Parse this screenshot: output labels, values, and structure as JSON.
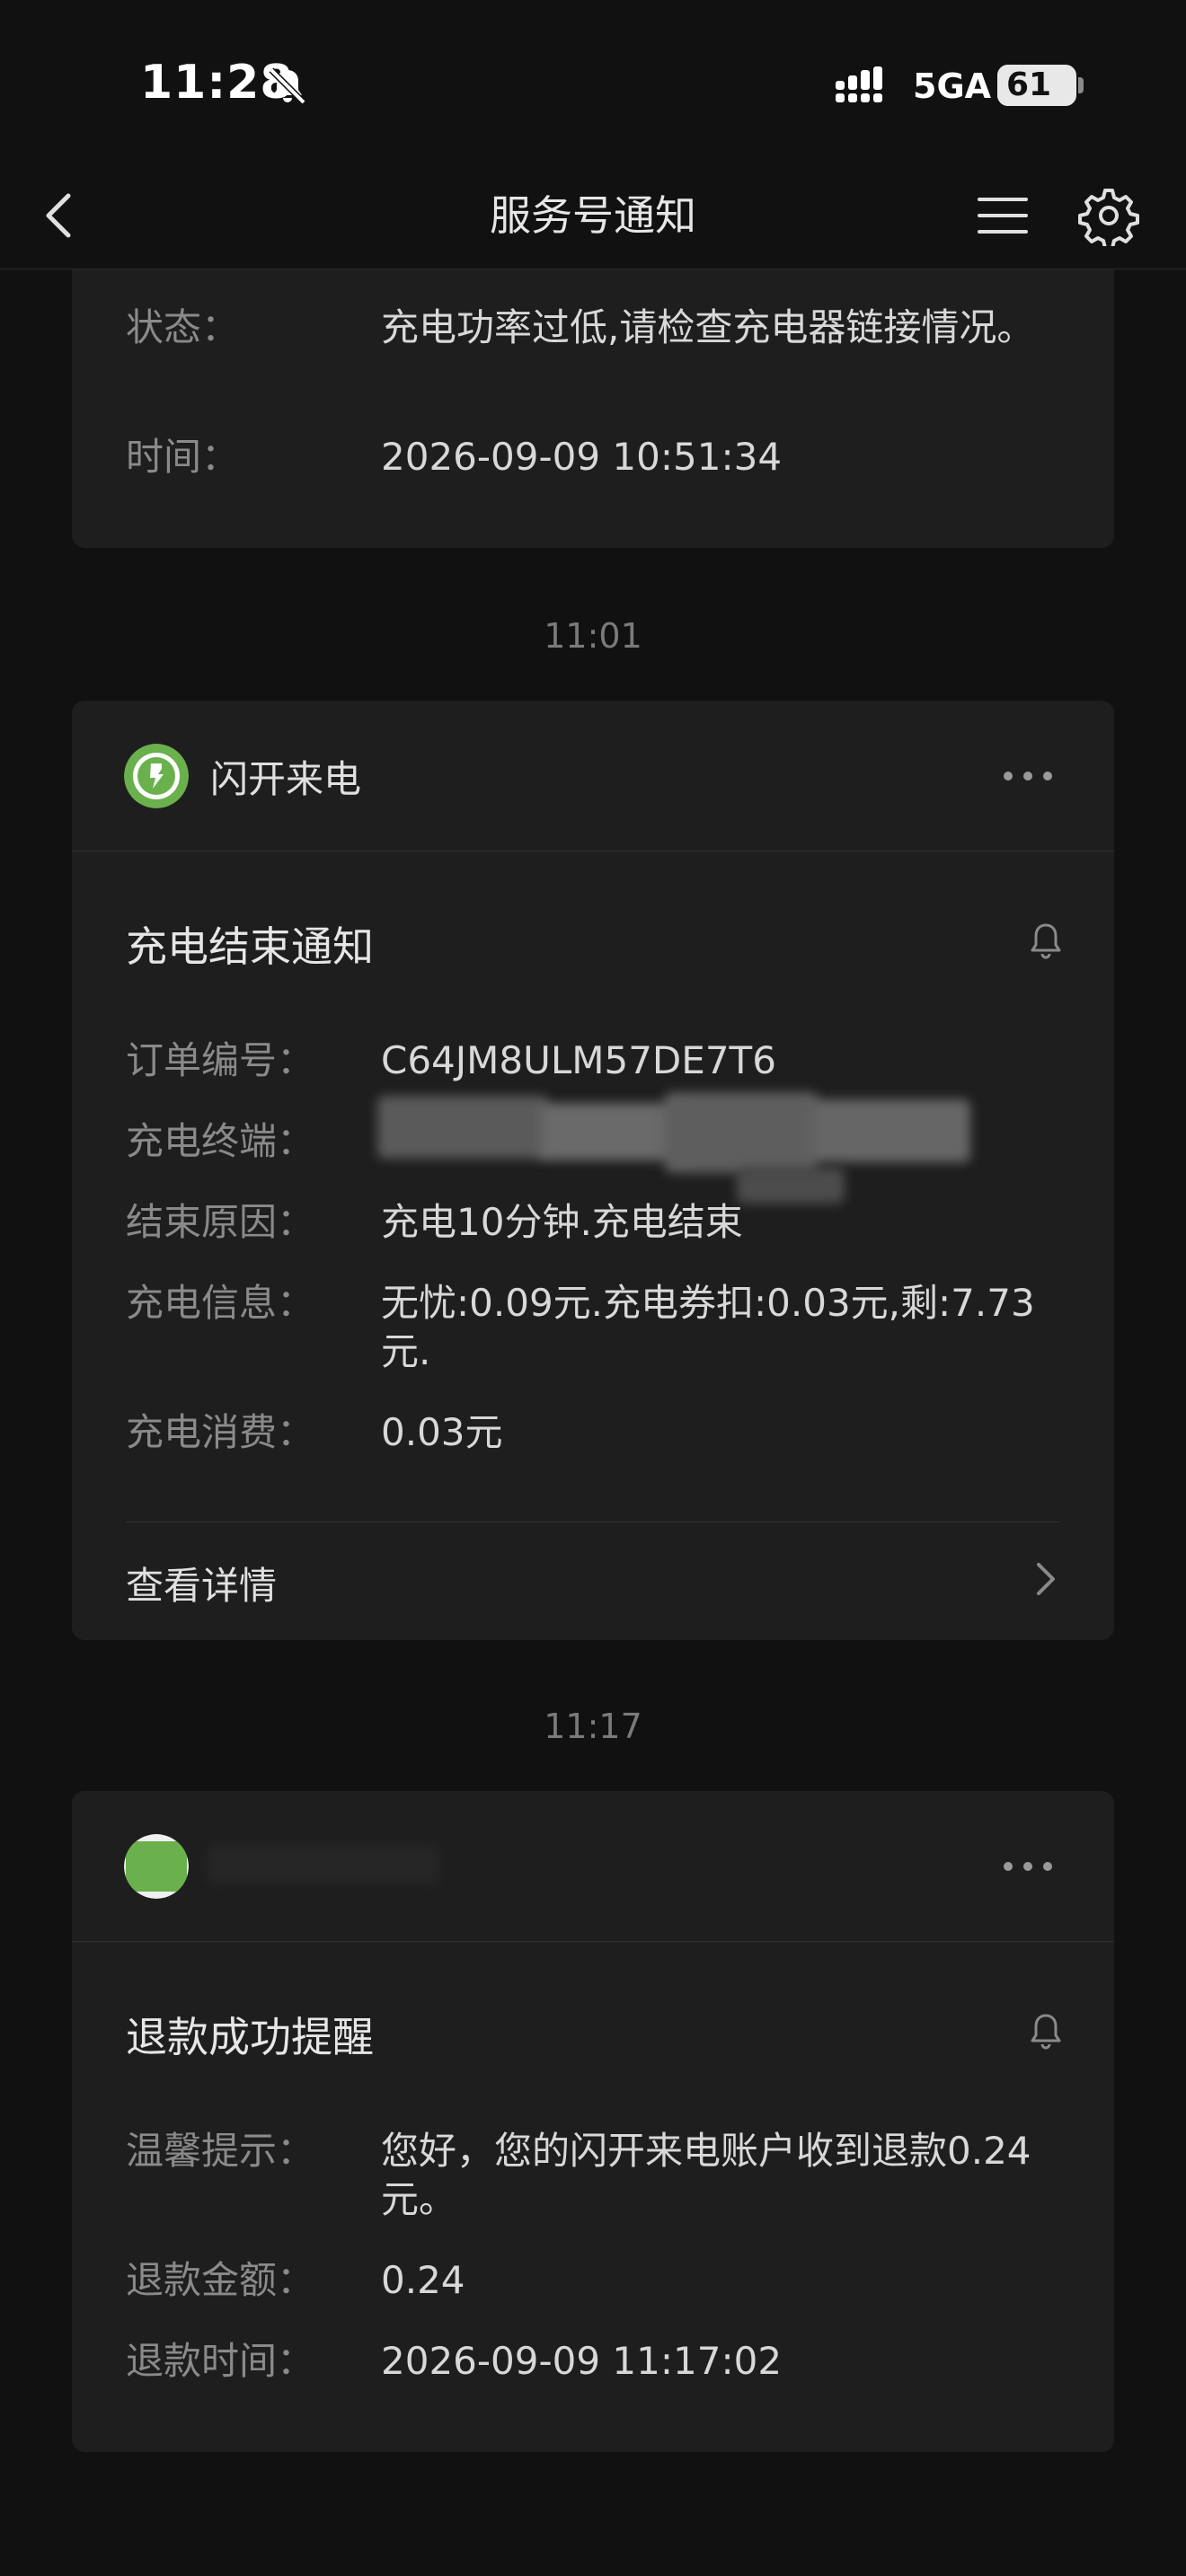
{
  "status_bar": {
    "time": "11:28",
    "network": "5GA",
    "battery": "61",
    "battery_level": 0.61
  },
  "nav": {
    "title": "服务号通知"
  },
  "messages": [
    {
      "fields": [
        {
          "label": "状态：",
          "value": "充电功率过低,请检查充电器链接情况。"
        },
        {
          "label": "时间：",
          "value": "2026-09-09 10:51:34"
        }
      ]
    },
    {
      "timestamp": "11:01",
      "sender": "闪开来电",
      "title": "充电结束通知",
      "fields": [
        {
          "label": "订单编号：",
          "value": "C64JM8ULM57DE7T6"
        },
        {
          "label": "充电终端：",
          "value": ""
        },
        {
          "label": "结束原因：",
          "value": "充电10分钟.充电结束"
        },
        {
          "label": "充电信息：",
          "value": "无忧:0.09元.充电券扣:0.03元,剩:7.73元."
        },
        {
          "label": "充电消费：",
          "value": "0.03元"
        }
      ],
      "action": "查看详情"
    },
    {
      "timestamp": "11:17",
      "sender": "",
      "title": "退款成功提醒",
      "fields": [
        {
          "label": "温馨提示：",
          "value": "您好，您的闪开来电账户收到退款0.24元。"
        },
        {
          "label": "退款金额：",
          "value": "0.24"
        },
        {
          "label": "退款时间：",
          "value": "2026-09-09 11:17:02"
        }
      ]
    }
  ],
  "colors": {
    "background": "#111111",
    "card": "#1e1e1e",
    "brand_green": "#6ab04c"
  }
}
